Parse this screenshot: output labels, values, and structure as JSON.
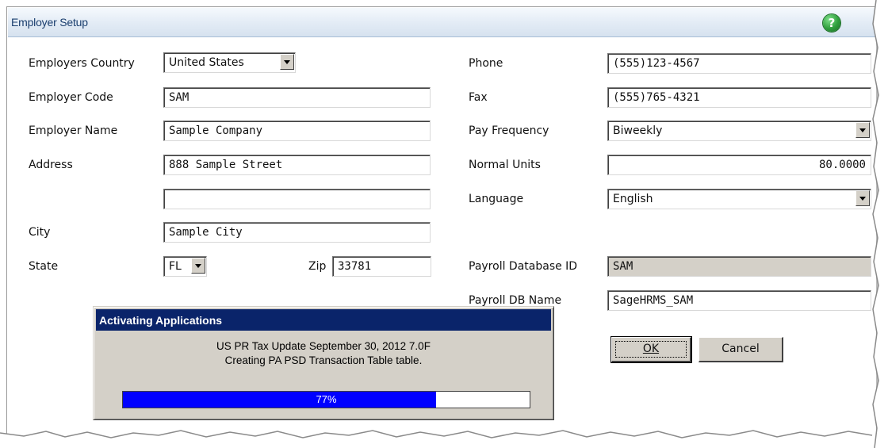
{
  "window": {
    "title": "Employer Setup",
    "help_icon": "question-circle-icon"
  },
  "left": {
    "employers_country": {
      "label": "Employers Country",
      "value": "United States"
    },
    "employer_code": {
      "label": "Employer Code",
      "value": "SAM"
    },
    "employer_name": {
      "label": "Employer Name",
      "value": "Sample Company"
    },
    "address": {
      "label": "Address",
      "line1": "888 Sample Street",
      "line2": ""
    },
    "city": {
      "label": "City",
      "value": "Sample City"
    },
    "state": {
      "label": "State",
      "value": "FL"
    },
    "zip": {
      "label": "Zip",
      "value": "33781"
    }
  },
  "right": {
    "phone": {
      "label": "Phone",
      "value": "(555)123-4567"
    },
    "fax": {
      "label": "Fax",
      "value": "(555)765-4321"
    },
    "pay_frequency": {
      "label": "Pay Frequency",
      "value": "Biweekly"
    },
    "normal_units": {
      "label": "Normal Units",
      "value": "80.0000"
    },
    "language": {
      "label": "Language",
      "value": "English"
    },
    "payroll_database_id": {
      "label": "Payroll Database ID",
      "value": "SAM"
    },
    "payroll_db_name": {
      "label": "Payroll DB Name",
      "value": "SageHRMS_SAM"
    }
  },
  "buttons": {
    "ok": "OK",
    "cancel": "Cancel"
  },
  "progress_dialog": {
    "title": "Activating Applications",
    "line1": "US PR Tax Update September 30, 2012 7.0F",
    "line2": "Creating PA PSD Transaction Table table.",
    "percent_label": "77%",
    "progress": 0.77
  },
  "colors": {
    "progress_fill": "#0000ff",
    "dialog_titlebar": "#0a246a",
    "help_icon": "#2e9e3c"
  }
}
